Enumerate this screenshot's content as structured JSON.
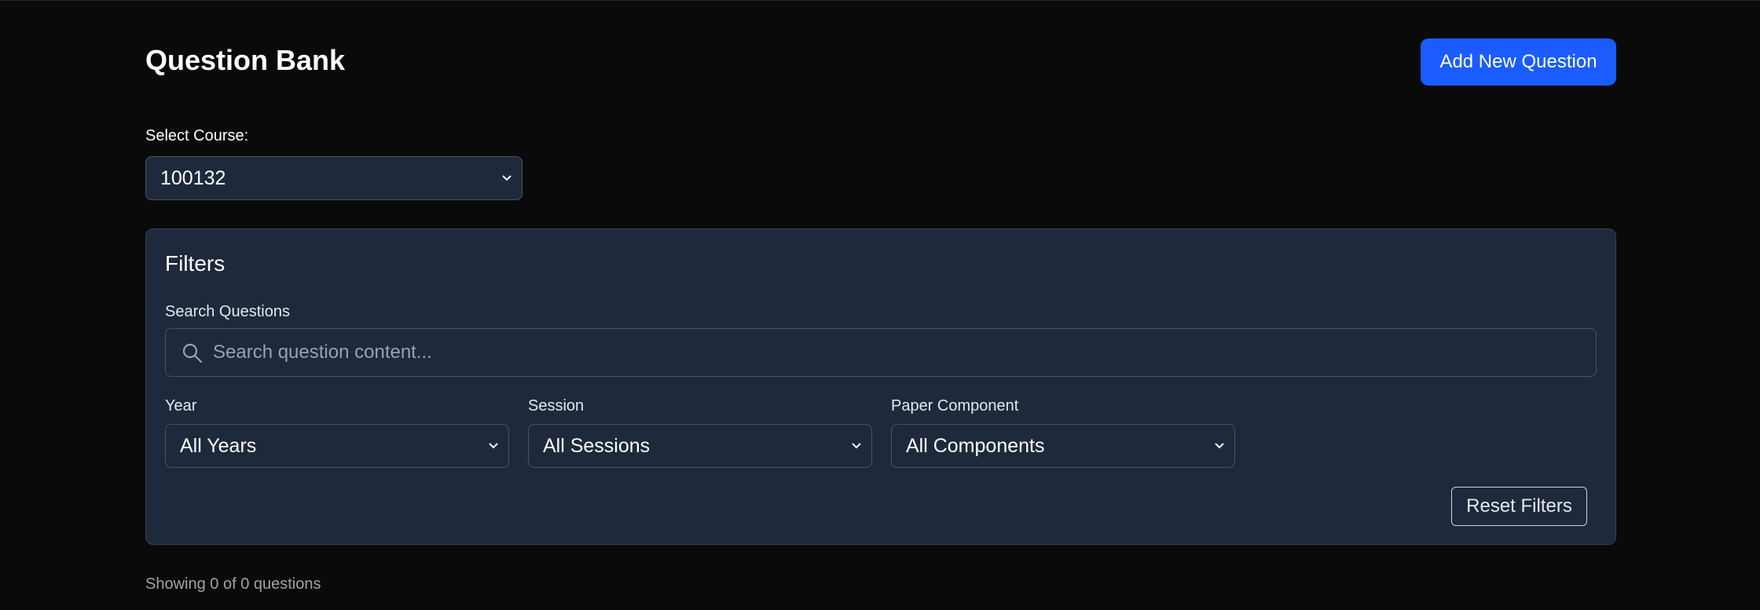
{
  "header": {
    "title": "Question Bank",
    "add_button_label": "Add New Question"
  },
  "course": {
    "label": "Select Course:",
    "selected": "100132"
  },
  "filters": {
    "title": "Filters",
    "search": {
      "label": "Search Questions",
      "placeholder": "Search question content...",
      "value": ""
    },
    "year": {
      "label": "Year",
      "selected": "All Years"
    },
    "session": {
      "label": "Session",
      "selected": "All Sessions"
    },
    "component": {
      "label": "Paper Component",
      "selected": "All Components"
    },
    "reset_label": "Reset Filters"
  },
  "results": {
    "summary": "Showing 0 of 0 questions"
  },
  "colors": {
    "background": "#0a0a0a",
    "panel": "#1e293b",
    "accent": "#1a5cff"
  },
  "icons": {
    "search": "search-icon",
    "dropdown": "chevron-down-icon"
  }
}
